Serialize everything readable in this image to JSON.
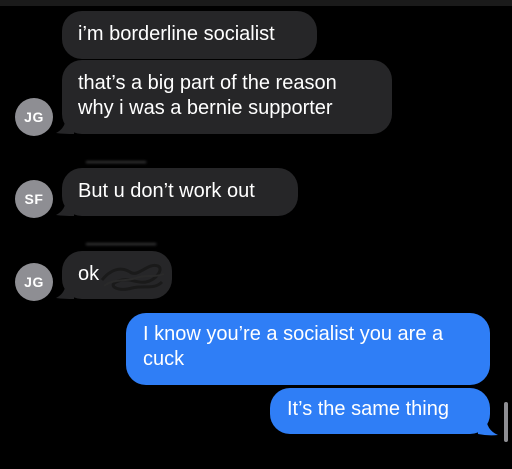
{
  "messages": [
    {
      "direction": "incoming",
      "text": "i’m borderline socialist"
    },
    {
      "direction": "incoming",
      "sender": "JG",
      "text": "that’s a big part of the reason why i was a bernie supporter"
    },
    {
      "direction": "incoming",
      "sender": "SF",
      "text": "But u don’t work out"
    },
    {
      "direction": "incoming",
      "sender": "JG",
      "text": "ok"
    },
    {
      "direction": "outgoing",
      "text": "I know you’re a socialist you are a cuck"
    },
    {
      "direction": "outgoing",
      "text": "It’s the same thing"
    }
  ],
  "avatars": [
    "JG",
    "SF",
    "JG"
  ],
  "colors": {
    "background": "#000000",
    "incoming_bubble": "#262628",
    "outgoing_bubble": "#2f7ef6",
    "avatar": "#8e8e93"
  }
}
